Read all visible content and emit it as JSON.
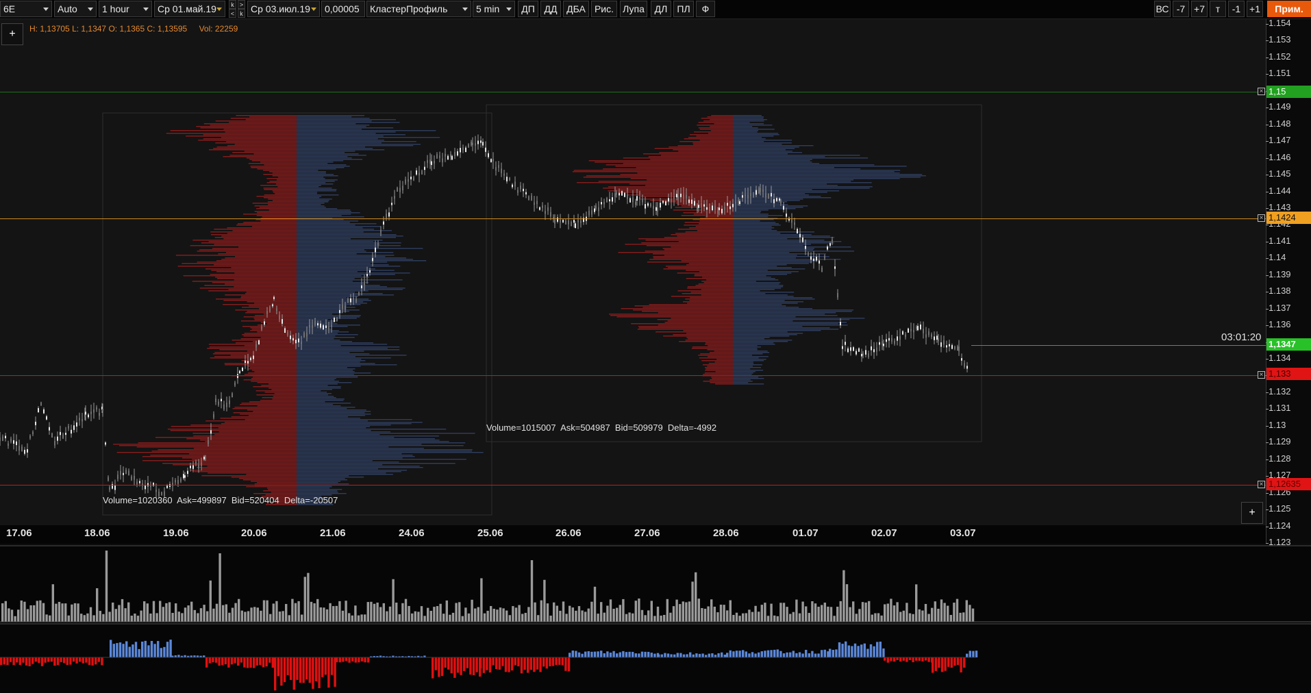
{
  "toolbar": {
    "symbol": "6E",
    "scale": "Auto",
    "timeframe": "1 hour",
    "date_from": "Ср 01.май.19",
    "nav_top_left": "k",
    "nav_top_right": ">",
    "nav_bottom_left": "<",
    "nav_bottom_right": "k",
    "date_to": "Ср 03.июл.19",
    "tick_size": "0,00005",
    "indicator": "КластерПрофиль",
    "profile_tf": "5 min",
    "buttons": [
      "ДП",
      "ДД",
      "ДБА",
      "Рис.",
      "Лупа",
      "ДЛ",
      "ПЛ",
      "Ф"
    ],
    "right_buttons": [
      "ВС",
      "-7",
      "+7",
      "т",
      "-1",
      "+1"
    ],
    "apply_label": "Прим."
  },
  "ohlc": {
    "high_label": "H: 1,13705",
    "low_label": "L: 1,1347",
    "open_label": "O: 1,1365",
    "close_label": "C: 1,13595",
    "vol_label": "Vol: 22259"
  },
  "price_axis": [
    "1.154",
    "1.153",
    "1.152",
    "1.151",
    "1.15",
    "1.149",
    "1.148",
    "1.147",
    "1.146",
    "1.145",
    "1.144",
    "1.143",
    "1.142",
    "1.141",
    "1.14",
    "1.139",
    "1.138",
    "1.137",
    "1.136",
    "1.135",
    "1.134",
    "1.133",
    "1.132",
    "1.131",
    "1.13",
    "1.129",
    "1.128",
    "1.127",
    "1.126",
    "1.125",
    "1.124",
    "1.123"
  ],
  "levels": [
    {
      "price": "1,15",
      "color": "#21a11f",
      "line": "#1e6e1e"
    },
    {
      "price": "1,1424",
      "color": "#f0a020",
      "line": "#d08a1c"
    },
    {
      "price": "1,1347",
      "color": "#28c228",
      "line": "#3aa33a"
    },
    {
      "price": "1,133",
      "color": "#e01414",
      "line": "#c41a1a"
    },
    {
      "price": "1,12635",
      "color": "#e01414",
      "line": "#c41a1a"
    }
  ],
  "timer": "03:01:20",
  "dates": [
    "17.06",
    "18.06",
    "19.06",
    "20.06",
    "21.06",
    "24.06",
    "25.06",
    "26.06",
    "27.06",
    "28.06",
    "01.07",
    "02.07",
    "03.07"
  ],
  "profiles": [
    {
      "stats": "Volume=1020360  Ask=499897  Bid=520404  Delta=-20507"
    },
    {
      "stats": "Volume=1015007  Ask=504987  Bid=509979  Delta=-4992"
    }
  ],
  "colors": {
    "ask": "#8a1c1c",
    "bid": "#2f3e60",
    "volume_bar": "#9a9a9a",
    "delta_pos": "#5b87d8",
    "delta_neg": "#e01010"
  }
}
